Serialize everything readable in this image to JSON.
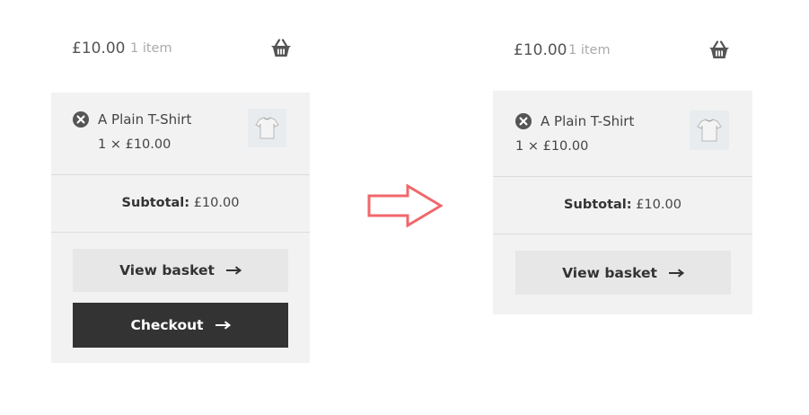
{
  "before": {
    "header": {
      "total": "£10.00",
      "count": "1 item"
    },
    "item": {
      "name": "A Plain T-Shirt",
      "qty": "1 × £10.00"
    },
    "subtotal": {
      "label": "Subtotal:",
      "value": "£10.00"
    },
    "buttons": {
      "view_basket": "View basket",
      "checkout": "Checkout"
    }
  },
  "after": {
    "header": {
      "total": "£10.00",
      "count": "1 item"
    },
    "item": {
      "name": "A Plain T-Shirt",
      "qty": "1 × £10.00"
    },
    "subtotal": {
      "label": "Subtotal:",
      "value": "£10.00"
    },
    "buttons": {
      "view_basket": "View basket"
    }
  },
  "icons": {
    "basket": "basket-icon",
    "remove": "remove-icon",
    "thumbnail": "tshirt-thumbnail",
    "button_arrow": "arrow-right-icon",
    "transition": "transition-arrow-icon"
  },
  "colors": {
    "checkout_bg": "#333333",
    "transition_arrow": "#f0676b"
  }
}
